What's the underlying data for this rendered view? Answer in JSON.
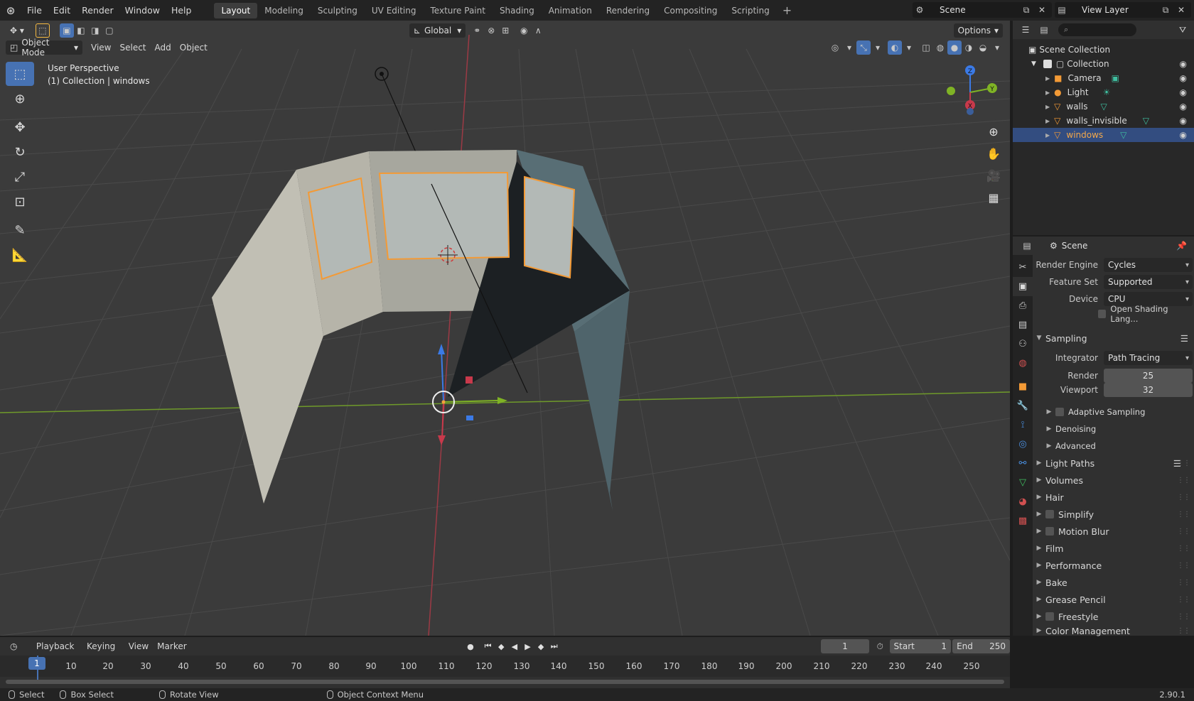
{
  "app": {
    "menu": [
      "File",
      "Edit",
      "Render",
      "Window",
      "Help"
    ],
    "workspaces": [
      "Layout",
      "Modeling",
      "Sculpting",
      "UV Editing",
      "Texture Paint",
      "Shading",
      "Animation",
      "Rendering",
      "Compositing",
      "Scripting"
    ],
    "active_workspace": "Layout",
    "scene_name": "Scene",
    "view_layer": "View Layer"
  },
  "viewport": {
    "transform_orientation": "Global",
    "options_label": "Options",
    "mode": "Object Mode",
    "menus": [
      "View",
      "Select",
      "Add",
      "Object"
    ],
    "info_line1": "User Perspective",
    "info_line2": "(1) Collection | windows",
    "gizmo_axes": {
      "z": "Z",
      "y": "Y",
      "x": "X"
    },
    "colors": {
      "x_axis": "#c8394b",
      "y_axis": "#7fb325",
      "z_axis": "#3b7ae6",
      "selected_outline": "#f39a36"
    }
  },
  "outliner": {
    "search_placeholder": "",
    "root": "Scene Collection",
    "collection": "Collection",
    "items": [
      {
        "name": "Camera",
        "type": "camera"
      },
      {
        "name": "Light",
        "type": "light"
      },
      {
        "name": "walls",
        "type": "mesh"
      },
      {
        "name": "walls_invisible",
        "type": "mesh"
      },
      {
        "name": "windows",
        "type": "mesh",
        "selected": true
      }
    ]
  },
  "properties": {
    "context": "Scene",
    "render_engine_label": "Render Engine",
    "render_engine": "Cycles",
    "feature_set_label": "Feature Set",
    "feature_set": "Supported",
    "device_label": "Device",
    "device": "CPU",
    "osl_label": "Open Shading Lang...",
    "sampling": "Sampling",
    "integrator_label": "Integrator",
    "integrator": "Path Tracing",
    "render_label": "Render",
    "render_samples": "25",
    "viewport_label": "Viewport",
    "viewport_samples": "32",
    "subsections": [
      "Adaptive Sampling",
      "Denoising",
      "Advanced"
    ],
    "sections": [
      "Light Paths",
      "Volumes",
      "Hair",
      "Simplify",
      "Motion Blur",
      "Film",
      "Performance",
      "Bake",
      "Grease Pencil",
      "Freestyle",
      "Color Management"
    ]
  },
  "timeline": {
    "menus": [
      "Playback",
      "Keying",
      "View",
      "Marker"
    ],
    "current_frame": "1",
    "start_label": "Start",
    "start": "1",
    "end_label": "End",
    "end": "250",
    "ticks": [
      "10",
      "20",
      "30",
      "40",
      "50",
      "60",
      "70",
      "80",
      "90",
      "100",
      "110",
      "120",
      "130",
      "140",
      "150",
      "160",
      "170",
      "180",
      "190",
      "200",
      "210",
      "220",
      "230",
      "240",
      "250"
    ],
    "frame_marker": "1"
  },
  "status": {
    "select": "Select",
    "box_select": "Box Select",
    "rotate_view": "Rotate View",
    "context_menu": "Object Context Menu",
    "version": "2.90.1"
  }
}
